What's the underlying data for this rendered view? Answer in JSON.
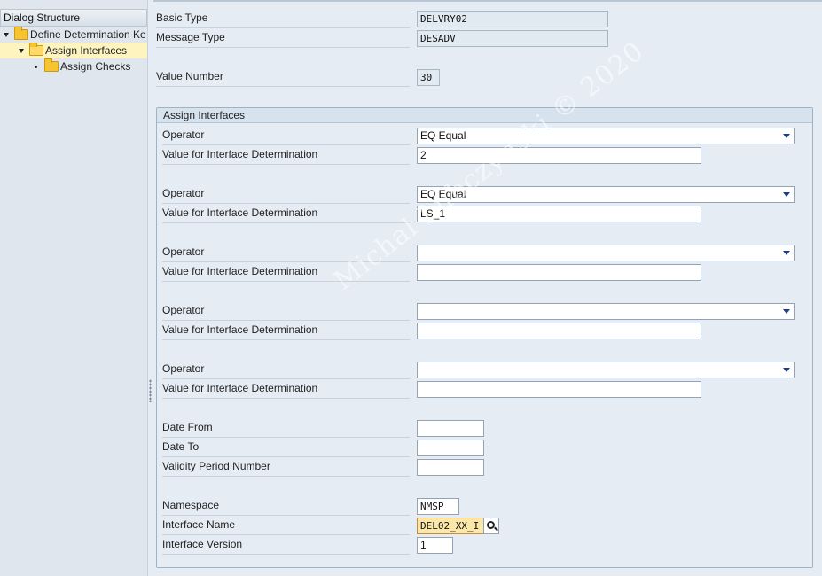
{
  "sidebar": {
    "header": "Dialog Structure",
    "items": [
      {
        "label": "Define Determination Ke"
      },
      {
        "label": "Assign Interfaces"
      },
      {
        "label": "Assign Checks"
      }
    ]
  },
  "header": {
    "basic_type_label": "Basic Type",
    "basic_type_value": "DELVRY02",
    "message_type_label": "Message Type",
    "message_type_value": "DESADV",
    "value_number_label": "Value Number",
    "value_number_value": "30"
  },
  "group": {
    "title": "Assign Interfaces",
    "pairs": [
      {
        "operator_label": "Operator",
        "operator_value": "EQ Equal",
        "value_label": "Value for Interface Determination",
        "value": "2"
      },
      {
        "operator_label": "Operator",
        "operator_value": "EQ Equal",
        "value_label": "Value for Interface Determination",
        "value": "LS_1"
      },
      {
        "operator_label": "Operator",
        "operator_value": "",
        "value_label": "Value for Interface Determination",
        "value": ""
      },
      {
        "operator_label": "Operator",
        "operator_value": "",
        "value_label": "Value for Interface Determination",
        "value": ""
      },
      {
        "operator_label": "Operator",
        "operator_value": "",
        "value_label": "Value for Interface Determination",
        "value": ""
      }
    ],
    "date_from_label": "Date From",
    "date_from_value": "",
    "date_to_label": "Date To",
    "date_to_value": "",
    "validity_label": "Validity Period Number",
    "validity_value": "",
    "namespace_label": "Namespace",
    "namespace_value": "NMSP",
    "interface_name_label": "Interface Name",
    "interface_name_value": "DEL02_XX_I",
    "interface_version_label": "Interface Version",
    "interface_version_value": "1"
  },
  "watermark": "Michal Lubczynski © 2020",
  "icons": {
    "folder": "folder-icon",
    "folder_open": "folder-open-icon",
    "search": "search-icon",
    "dropdown": "chevron-down-icon"
  },
  "colors": {
    "background": "#e5ecf3",
    "selected_row": "#fdf4bf",
    "folder": "#f7c430",
    "focus_field": "#fbe7a8"
  }
}
